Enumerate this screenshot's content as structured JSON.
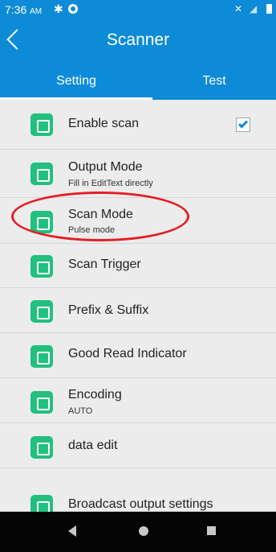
{
  "status": {
    "time": "7:36",
    "ampm": "AM",
    "icons": [
      "gear-icon",
      "app-icon",
      "mute-icon",
      "wifi-icon",
      "battery-icon"
    ]
  },
  "header": {
    "title": "Scanner"
  },
  "tabs": [
    {
      "label": "Setting",
      "active": true
    },
    {
      "label": "Test",
      "active": false
    }
  ],
  "settings": [
    {
      "title": "Enable scan",
      "subtitle": "",
      "icon": "enable-scan-icon",
      "checked": true
    },
    {
      "title": "Output Mode",
      "subtitle": "Fill in EditText directly",
      "icon": "output-mode-icon"
    },
    {
      "title": "Scan Mode",
      "subtitle": "Pulse mode",
      "icon": "scan-mode-icon"
    },
    {
      "title": "Scan Trigger",
      "subtitle": "",
      "icon": "scan-trigger-icon"
    },
    {
      "title": "Prefix & Suffix",
      "subtitle": "",
      "icon": "prefix-suffix-icon"
    },
    {
      "title": "Good Read Indicator",
      "subtitle": "",
      "icon": "good-read-icon"
    },
    {
      "title": "Encoding",
      "subtitle": "AUTO",
      "icon": "encoding-icon"
    },
    {
      "title": "data edit",
      "subtitle": "",
      "icon": "data-edit-icon"
    },
    {
      "title": "Broadcast output settings",
      "subtitle": "",
      "icon": "broadcast-icon"
    }
  ],
  "colors": {
    "accent": "#0d8bd6",
    "iconGreen": "#21c07e",
    "highlight": "#e21f26",
    "background": "#ececec"
  },
  "navigation": {
    "icons": [
      "nav-back-icon",
      "nav-home-icon",
      "nav-recent-icon"
    ]
  }
}
